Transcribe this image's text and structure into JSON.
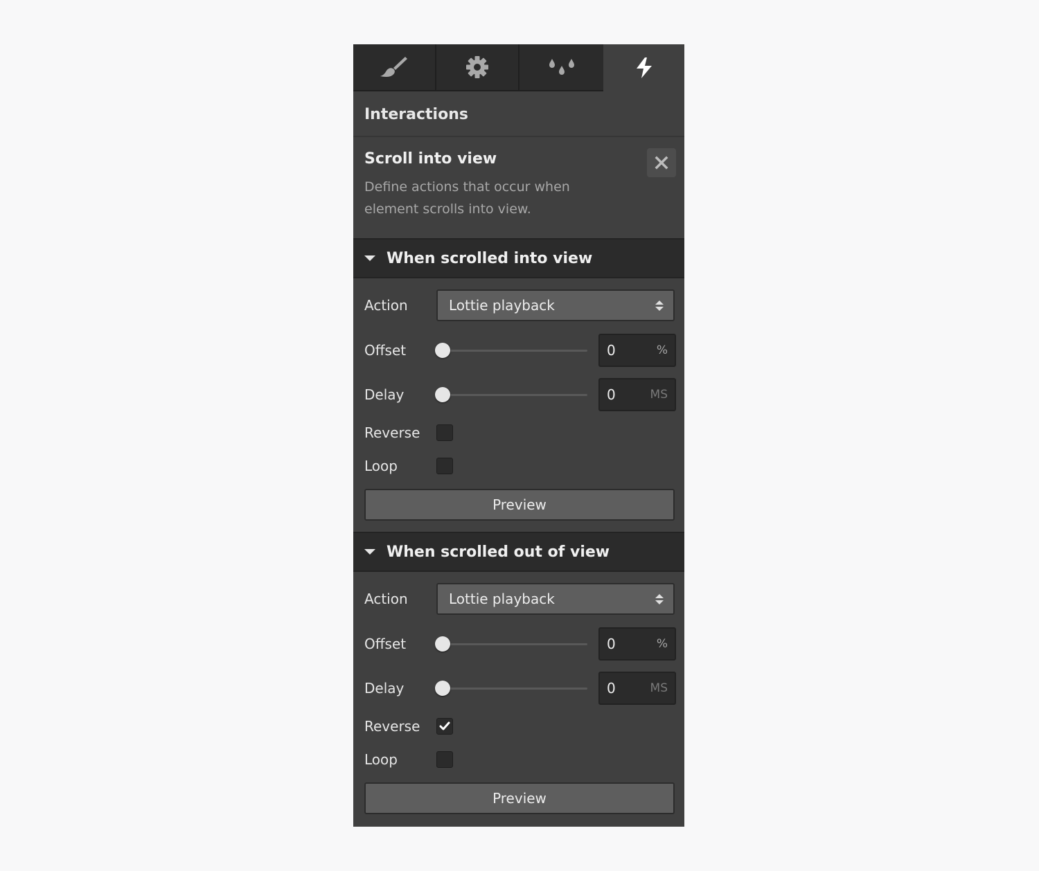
{
  "tabs": [
    {
      "name": "style",
      "icon": "brush-icon",
      "active": false
    },
    {
      "name": "settings",
      "icon": "gear-icon",
      "active": false
    },
    {
      "name": "style-manager",
      "icon": "drops-icon",
      "active": false
    },
    {
      "name": "interactions",
      "icon": "lightning-icon",
      "active": true
    }
  ],
  "section_title": "Interactions",
  "trigger": {
    "title": "Scroll into view",
    "description": "Define actions that occur when element scrolls into view.",
    "close_icon": "close-icon"
  },
  "groups": [
    {
      "title": "When scrolled into view",
      "action_label": "Action",
      "action_value": "Lottie playback",
      "offset_label": "Offset",
      "offset_value": "0",
      "offset_unit": "%",
      "offset_slider": 0,
      "delay_label": "Delay",
      "delay_value": "0",
      "delay_unit": "MS",
      "delay_slider": 0,
      "reverse_label": "Reverse",
      "reverse_checked": false,
      "loop_label": "Loop",
      "loop_checked": false,
      "preview_label": "Preview"
    },
    {
      "title": "When scrolled out of view",
      "action_label": "Action",
      "action_value": "Lottie playback",
      "offset_label": "Offset",
      "offset_value": "0",
      "offset_unit": "%",
      "offset_slider": 0,
      "delay_label": "Delay",
      "delay_value": "0",
      "delay_unit": "MS",
      "delay_slider": 0,
      "reverse_label": "Reverse",
      "reverse_checked": true,
      "loop_label": "Loop",
      "loop_checked": false,
      "preview_label": "Preview"
    }
  ]
}
